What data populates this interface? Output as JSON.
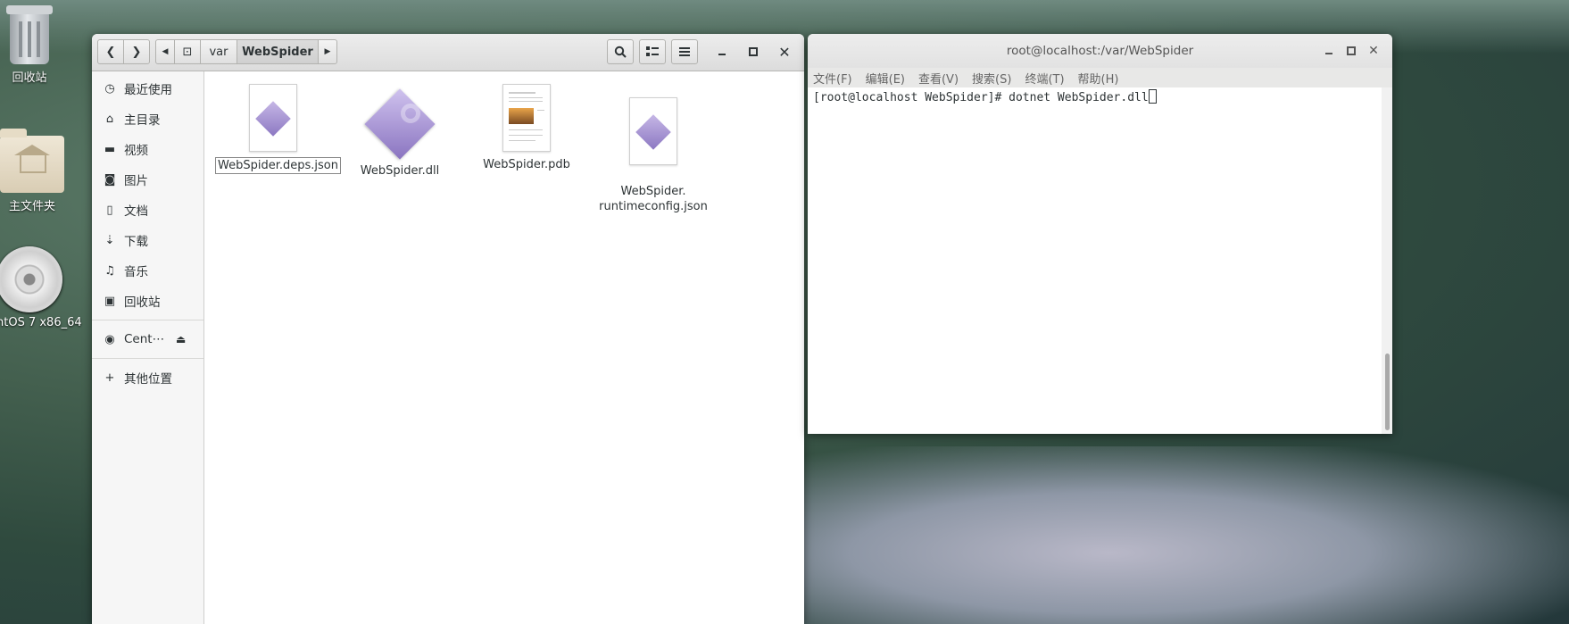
{
  "desktop": {
    "icons": [
      {
        "label": "回收站"
      },
      {
        "label": "主文件夹"
      },
      {
        "label": "ntOS 7 x86_64"
      }
    ]
  },
  "files_window": {
    "path": [
      "var",
      "WebSpider"
    ],
    "sidebar": {
      "places": [
        {
          "label": "最近使用",
          "icon": "clock-icon"
        },
        {
          "label": "主目录",
          "icon": "home-icon"
        },
        {
          "label": "视频",
          "icon": "video-icon"
        },
        {
          "label": "图片",
          "icon": "camera-icon"
        },
        {
          "label": "文档",
          "icon": "document-icon"
        },
        {
          "label": "下载",
          "icon": "download-icon"
        },
        {
          "label": "音乐",
          "icon": "music-icon"
        },
        {
          "label": "回收站",
          "icon": "trash-icon"
        }
      ],
      "devices": [
        {
          "label": "Cent⋯",
          "icon": "disc-icon"
        }
      ],
      "other": {
        "label": "其他位置",
        "icon": "plus-icon"
      }
    },
    "files": [
      {
        "name": "WebSpider.deps.json",
        "type": "json"
      },
      {
        "name": "WebSpider.dll",
        "type": "dll"
      },
      {
        "name": "WebSpider.pdb",
        "type": "pdb"
      },
      {
        "name": "WebSpider.\nruntimeconfig.json",
        "type": "json"
      }
    ]
  },
  "terminal": {
    "title": "root@localhost:/var/WebSpider",
    "menu": [
      "文件(F)",
      "编辑(E)",
      "查看(V)",
      "搜索(S)",
      "终端(T)",
      "帮助(H)"
    ],
    "prompt": "[root@localhost WebSpider]# dotnet WebSpider.dll"
  }
}
